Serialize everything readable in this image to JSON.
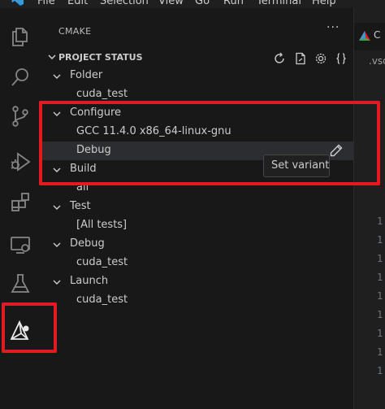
{
  "menu": {
    "items": [
      "File",
      "Edit",
      "Selection",
      "View",
      "Go",
      "Run",
      "Terminal",
      "Help"
    ]
  },
  "sidebar": {
    "title": "CMAKE",
    "more": "···",
    "section_title": "PROJECT STATUS",
    "tree": {
      "folder": "Folder",
      "folder_value": "cuda_test",
      "configure": "Configure",
      "configure_compiler": "GCC 11.4.0 x86_64-linux-gnu",
      "configure_variant": "Debug",
      "build": "Build",
      "build_target": "all",
      "test": "Test",
      "test_value": "[All tests]",
      "debug": "Debug",
      "debug_target": "cuda_test",
      "launch": "Launch",
      "launch_target": "cuda_test"
    },
    "tooltip": "Set variant"
  },
  "editor": {
    "tab_text": "C",
    "breadcrumb": ".vsc",
    "line_fragment": "1"
  },
  "colors": {
    "highlight_border": "#e21b23",
    "logo_blue": "#3c99d4",
    "cmake_red": "#e21b23"
  }
}
